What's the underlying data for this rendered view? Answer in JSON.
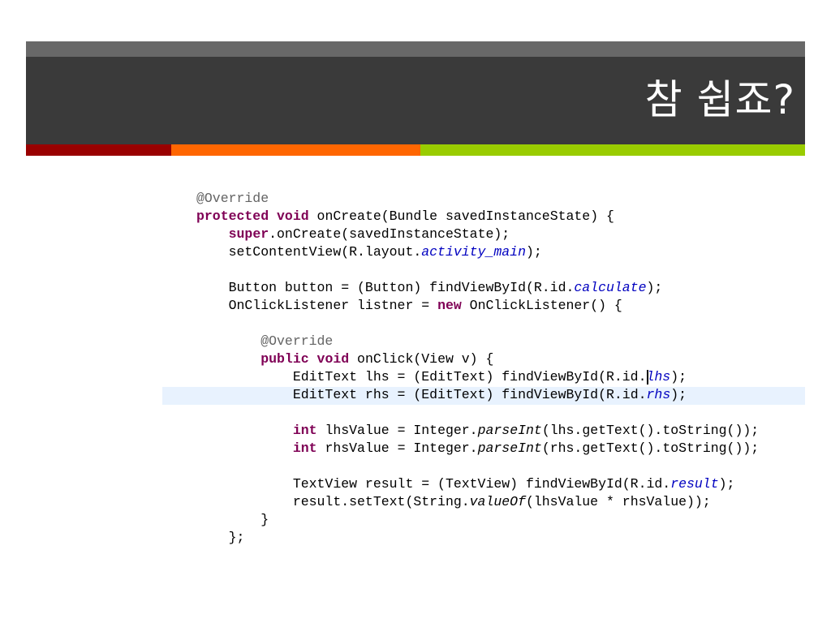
{
  "slide": {
    "title": "참 쉽죠?",
    "accent_colors": [
      "#990000",
      "#ff6600",
      "#99cc00"
    ]
  },
  "code": {
    "highlighted_line": 10,
    "cursor": {
      "line": 10,
      "after_token": 1
    },
    "lines": [
      [
        [
          "@Override",
          "an"
        ]
      ],
      [
        [
          "protected",
          "kw"
        ],
        [
          " ",
          ""
        ],
        [
          "void",
          "kw"
        ],
        [
          " onCreate(Bundle savedInstanceState) {",
          ""
        ]
      ],
      [
        [
          "    ",
          ""
        ],
        [
          "super",
          "kw"
        ],
        [
          ".onCreate(savedInstanceState);",
          ""
        ]
      ],
      [
        [
          "    setContentView(R.layout.",
          ""
        ],
        [
          "activity_main",
          "it"
        ],
        [
          ");",
          ""
        ]
      ],
      [],
      [
        [
          "    Button button = (Button) findViewById(R.id.",
          ""
        ],
        [
          "calculate",
          "it"
        ],
        [
          ");",
          ""
        ]
      ],
      [
        [
          "    OnClickListener listner = ",
          ""
        ],
        [
          "new",
          "kw"
        ],
        [
          " OnClickListener() {",
          ""
        ]
      ],
      [],
      [
        [
          "        ",
          ""
        ],
        [
          "@Override",
          "an"
        ]
      ],
      [
        [
          "        ",
          ""
        ],
        [
          "public",
          "kw"
        ],
        [
          " ",
          ""
        ],
        [
          "void",
          "kw"
        ],
        [
          " onClick(View v) {",
          ""
        ]
      ],
      [
        [
          "            EditText lhs = (EditText) findViewById(R.id.",
          ""
        ],
        [
          "lhs",
          "it"
        ],
        [
          ");",
          ""
        ]
      ],
      [
        [
          "            EditText rhs = (EditText) findViewById",
          ""
        ],
        [
          "(R.id.",
          ""
        ],
        [
          "rhs",
          "it"
        ],
        [
          ");",
          ""
        ]
      ],
      [],
      [
        [
          "            ",
          ""
        ],
        [
          "int",
          "kw"
        ],
        [
          " lhsValue = Integer.",
          ""
        ],
        [
          "parseInt",
          "sit"
        ],
        [
          "(lhs.getText().toString());",
          ""
        ]
      ],
      [
        [
          "            ",
          ""
        ],
        [
          "int",
          "kw"
        ],
        [
          " rhsValue = Integer.",
          ""
        ],
        [
          "parseInt",
          "sit"
        ],
        [
          "(rhs.getText().toString());",
          ""
        ]
      ],
      [],
      [
        [
          "            TextView result = (TextView) findViewById(R.id.",
          ""
        ],
        [
          "result",
          "it"
        ],
        [
          ");",
          ""
        ]
      ],
      [
        [
          "            result.setText(String.",
          ""
        ],
        [
          "valueOf",
          "sit"
        ],
        [
          "(lhsValue * rhsValue));",
          ""
        ]
      ],
      [
        [
          "        }",
          ""
        ]
      ],
      [
        [
          "    };",
          ""
        ]
      ]
    ]
  }
}
